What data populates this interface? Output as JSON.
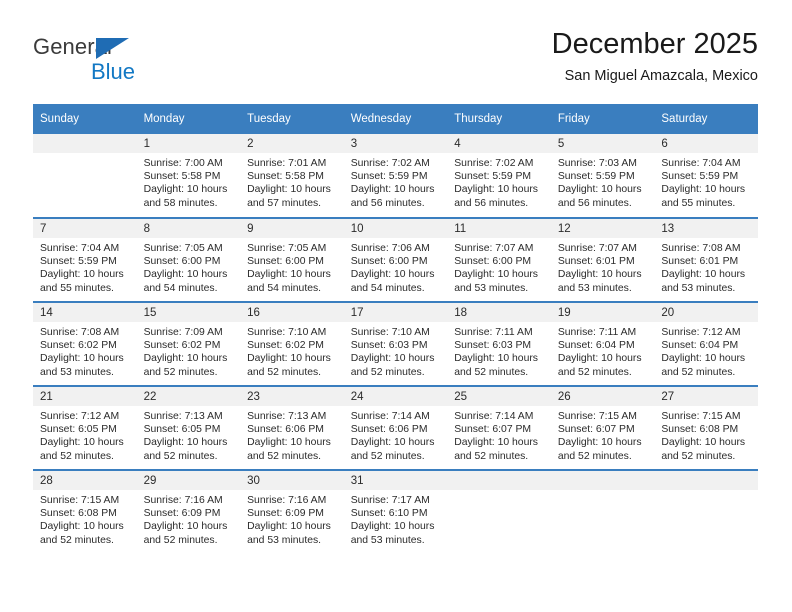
{
  "brand": {
    "name_part1": "General",
    "name_part2": "Blue",
    "color_primary": "#1278c4",
    "color_triangle": "#1f6cb4"
  },
  "header": {
    "title": "December 2025",
    "subtitle": "San Miguel Amazcala, Mexico"
  },
  "theme": {
    "header_bg": "#3a7ebf",
    "daynum_bg": "#f1f1f1",
    "row_border": "#3a7ebf",
    "text": "#2b2b2b"
  },
  "calendar": {
    "weekday_headers": [
      "Sunday",
      "Monday",
      "Tuesday",
      "Wednesday",
      "Thursday",
      "Friday",
      "Saturday"
    ],
    "weeks": [
      [
        {
          "day": "",
          "sunrise": "",
          "sunset": "",
          "daylight": "",
          "blank": true
        },
        {
          "day": "1",
          "sunrise": "Sunrise: 7:00 AM",
          "sunset": "Sunset: 5:58 PM",
          "daylight": "Daylight: 10 hours and 58 minutes."
        },
        {
          "day": "2",
          "sunrise": "Sunrise: 7:01 AM",
          "sunset": "Sunset: 5:58 PM",
          "daylight": "Daylight: 10 hours and 57 minutes."
        },
        {
          "day": "3",
          "sunrise": "Sunrise: 7:02 AM",
          "sunset": "Sunset: 5:59 PM",
          "daylight": "Daylight: 10 hours and 56 minutes."
        },
        {
          "day": "4",
          "sunrise": "Sunrise: 7:02 AM",
          "sunset": "Sunset: 5:59 PM",
          "daylight": "Daylight: 10 hours and 56 minutes."
        },
        {
          "day": "5",
          "sunrise": "Sunrise: 7:03 AM",
          "sunset": "Sunset: 5:59 PM",
          "daylight": "Daylight: 10 hours and 56 minutes."
        },
        {
          "day": "6",
          "sunrise": "Sunrise: 7:04 AM",
          "sunset": "Sunset: 5:59 PM",
          "daylight": "Daylight: 10 hours and 55 minutes."
        }
      ],
      [
        {
          "day": "7",
          "sunrise": "Sunrise: 7:04 AM",
          "sunset": "Sunset: 5:59 PM",
          "daylight": "Daylight: 10 hours and 55 minutes."
        },
        {
          "day": "8",
          "sunrise": "Sunrise: 7:05 AM",
          "sunset": "Sunset: 6:00 PM",
          "daylight": "Daylight: 10 hours and 54 minutes."
        },
        {
          "day": "9",
          "sunrise": "Sunrise: 7:05 AM",
          "sunset": "Sunset: 6:00 PM",
          "daylight": "Daylight: 10 hours and 54 minutes."
        },
        {
          "day": "10",
          "sunrise": "Sunrise: 7:06 AM",
          "sunset": "Sunset: 6:00 PM",
          "daylight": "Daylight: 10 hours and 54 minutes."
        },
        {
          "day": "11",
          "sunrise": "Sunrise: 7:07 AM",
          "sunset": "Sunset: 6:00 PM",
          "daylight": "Daylight: 10 hours and 53 minutes."
        },
        {
          "day": "12",
          "sunrise": "Sunrise: 7:07 AM",
          "sunset": "Sunset: 6:01 PM",
          "daylight": "Daylight: 10 hours and 53 minutes."
        },
        {
          "day": "13",
          "sunrise": "Sunrise: 7:08 AM",
          "sunset": "Sunset: 6:01 PM",
          "daylight": "Daylight: 10 hours and 53 minutes."
        }
      ],
      [
        {
          "day": "14",
          "sunrise": "Sunrise: 7:08 AM",
          "sunset": "Sunset: 6:02 PM",
          "daylight": "Daylight: 10 hours and 53 minutes."
        },
        {
          "day": "15",
          "sunrise": "Sunrise: 7:09 AM",
          "sunset": "Sunset: 6:02 PM",
          "daylight": "Daylight: 10 hours and 52 minutes."
        },
        {
          "day": "16",
          "sunrise": "Sunrise: 7:10 AM",
          "sunset": "Sunset: 6:02 PM",
          "daylight": "Daylight: 10 hours and 52 minutes."
        },
        {
          "day": "17",
          "sunrise": "Sunrise: 7:10 AM",
          "sunset": "Sunset: 6:03 PM",
          "daylight": "Daylight: 10 hours and 52 minutes."
        },
        {
          "day": "18",
          "sunrise": "Sunrise: 7:11 AM",
          "sunset": "Sunset: 6:03 PM",
          "daylight": "Daylight: 10 hours and 52 minutes."
        },
        {
          "day": "19",
          "sunrise": "Sunrise: 7:11 AM",
          "sunset": "Sunset: 6:04 PM",
          "daylight": "Daylight: 10 hours and 52 minutes."
        },
        {
          "day": "20",
          "sunrise": "Sunrise: 7:12 AM",
          "sunset": "Sunset: 6:04 PM",
          "daylight": "Daylight: 10 hours and 52 minutes."
        }
      ],
      [
        {
          "day": "21",
          "sunrise": "Sunrise: 7:12 AM",
          "sunset": "Sunset: 6:05 PM",
          "daylight": "Daylight: 10 hours and 52 minutes."
        },
        {
          "day": "22",
          "sunrise": "Sunrise: 7:13 AM",
          "sunset": "Sunset: 6:05 PM",
          "daylight": "Daylight: 10 hours and 52 minutes."
        },
        {
          "day": "23",
          "sunrise": "Sunrise: 7:13 AM",
          "sunset": "Sunset: 6:06 PM",
          "daylight": "Daylight: 10 hours and 52 minutes."
        },
        {
          "day": "24",
          "sunrise": "Sunrise: 7:14 AM",
          "sunset": "Sunset: 6:06 PM",
          "daylight": "Daylight: 10 hours and 52 minutes."
        },
        {
          "day": "25",
          "sunrise": "Sunrise: 7:14 AM",
          "sunset": "Sunset: 6:07 PM",
          "daylight": "Daylight: 10 hours and 52 minutes."
        },
        {
          "day": "26",
          "sunrise": "Sunrise: 7:15 AM",
          "sunset": "Sunset: 6:07 PM",
          "daylight": "Daylight: 10 hours and 52 minutes."
        },
        {
          "day": "27",
          "sunrise": "Sunrise: 7:15 AM",
          "sunset": "Sunset: 6:08 PM",
          "daylight": "Daylight: 10 hours and 52 minutes."
        }
      ],
      [
        {
          "day": "28",
          "sunrise": "Sunrise: 7:15 AM",
          "sunset": "Sunset: 6:08 PM",
          "daylight": "Daylight: 10 hours and 52 minutes."
        },
        {
          "day": "29",
          "sunrise": "Sunrise: 7:16 AM",
          "sunset": "Sunset: 6:09 PM",
          "daylight": "Daylight: 10 hours and 52 minutes."
        },
        {
          "day": "30",
          "sunrise": "Sunrise: 7:16 AM",
          "sunset": "Sunset: 6:09 PM",
          "daylight": "Daylight: 10 hours and 53 minutes."
        },
        {
          "day": "31",
          "sunrise": "Sunrise: 7:17 AM",
          "sunset": "Sunset: 6:10 PM",
          "daylight": "Daylight: 10 hours and 53 minutes."
        },
        {
          "day": "",
          "sunrise": "",
          "sunset": "",
          "daylight": "",
          "blank": true
        },
        {
          "day": "",
          "sunrise": "",
          "sunset": "",
          "daylight": "",
          "blank": true
        },
        {
          "day": "",
          "sunrise": "",
          "sunset": "",
          "daylight": "",
          "blank": true
        }
      ]
    ]
  }
}
